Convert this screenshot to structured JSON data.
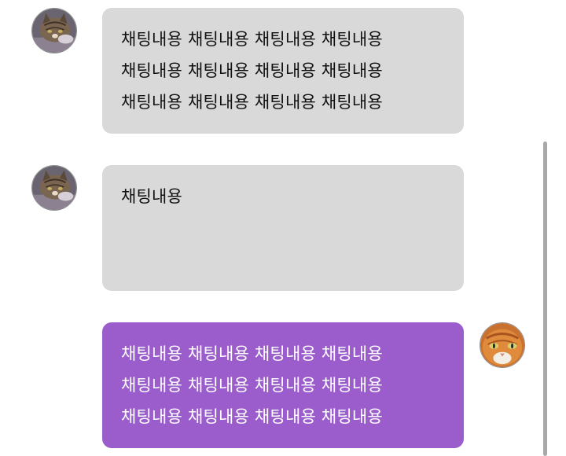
{
  "messages": [
    {
      "sender": "other",
      "avatar": "cat-avatar-tabby",
      "lines": [
        "채팅내용 채팅내용 채팅내용 채팅내용",
        "채팅내용 채팅내용 채팅내용 채팅내용",
        "채팅내용 채팅내용 채팅내용 채팅내용"
      ]
    },
    {
      "sender": "other",
      "avatar": "cat-avatar-tabby",
      "lines": [
        "채팅내용"
      ]
    },
    {
      "sender": "me",
      "avatar": "cat-avatar-orange",
      "lines": [
        "채팅내용 채팅내용 채팅내용 채팅내용",
        "채팅내용 채팅내용 채팅내용 채팅내용",
        "채팅내용 채팅내용 채팅내용 채팅내용"
      ]
    }
  ],
  "colors": {
    "incoming_bubble": "#d9d9d9",
    "outgoing_bubble": "#9b5dcb",
    "scrollbar": "#a8a8a8"
  }
}
